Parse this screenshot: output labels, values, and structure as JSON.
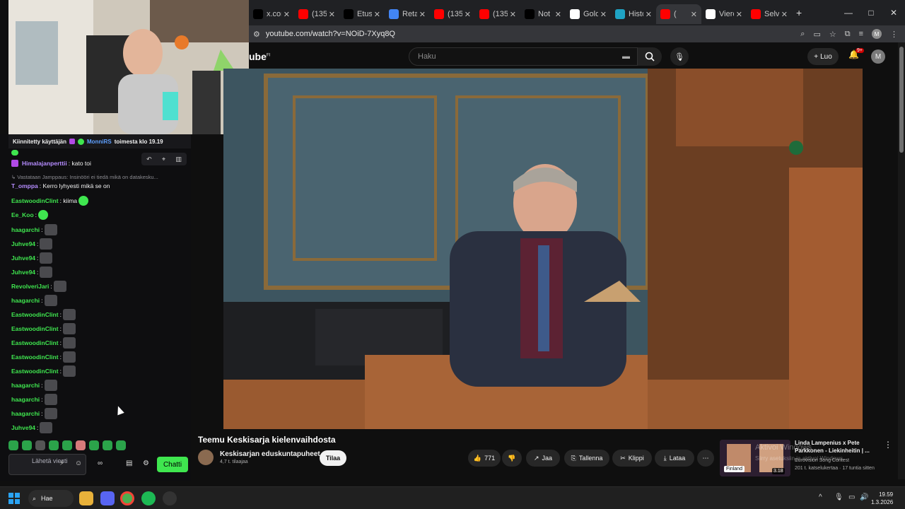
{
  "browser": {
    "tabs": [
      {
        "label": "x.com",
        "icon": "x-icon",
        "color": "#000000"
      },
      {
        "label": "(135",
        "icon": "youtube-icon",
        "color": "#ff0000"
      },
      {
        "label": "Etusi",
        "icon": "x-icon",
        "color": "#000000"
      },
      {
        "label": "Reta",
        "icon": "google-icon",
        "color": "#4285f4"
      },
      {
        "label": "(135",
        "icon": "youtube-icon",
        "color": "#ff0000"
      },
      {
        "label": "(135",
        "icon": "youtube-icon",
        "color": "#ff0000"
      },
      {
        "label": "Not",
        "icon": "x-icon",
        "color": "#000000"
      },
      {
        "label": "Gold",
        "icon": "doc-icon",
        "color": "#ffffff"
      },
      {
        "label": "Histo",
        "icon": "app-icon",
        "color": "#1fa3c4"
      },
      {
        "label": "(",
        "icon": "youtube-icon",
        "color": "#ff0000"
      },
      {
        "label": "Vierc",
        "icon": "doc-icon",
        "color": "#ffffff"
      },
      {
        "label": "Selvi",
        "icon": "youtube-icon",
        "color": "#ff0000"
      }
    ],
    "url": "youtube.com/watch?v=NOiD-7Xyq8Q",
    "profile_initial": "M"
  },
  "youtube": {
    "logo_text": "ube",
    "logo_region": "FI",
    "search_placeholder": "Haku",
    "create_label": "Luo",
    "notif_badge": "9+",
    "user_initial": "M",
    "video_title": "Teemu Keskisarja kielenvaihdosta",
    "channel_name": "Keskisarjan eduskuntapuheet",
    "channel_subs": "4,7 t. tilaajaa",
    "subscribe_label": "Tilaa",
    "likes": "771",
    "share_label": "Jaa",
    "save_label": "Tallenna",
    "clip_label": "Klippi",
    "download_label": "Lataa",
    "recommendation": {
      "title": "Linda Lampenius x Pete Parkkonen - Liekinheitin | ...",
      "channel": "Eurovision Song Contest",
      "views": "201 t. katselukertaa · 17 tuntia sitten",
      "duration": "3.18",
      "thumb_text": "Finland"
    },
    "watermark_line1": "Aktivoi Windows",
    "watermark_line2": "Siirry asetuksiin ja aktivoi Windows."
  },
  "chat": {
    "pinned_prefix": "Kiinnitetty käyttäjän",
    "pinned_user": "MonniRS",
    "pinned_suffix": "toimesta klo 19.19",
    "reply_context": "Vastataan Jamppaus: Insinööri ei tiedä mikä on datakesku...",
    "messages": [
      {
        "user": "Himalajanperttii",
        "text": ": kato toi",
        "color": "#ffffff"
      },
      {
        "user": "T_omppa",
        "text": ": Kerro lyhyesti mikä se on",
        "color": "#9b59ff"
      },
      {
        "user": "EastwoodinClint",
        "text": ": kiima",
        "color": "#3fe64f"
      },
      {
        "user": "Ee_Koo",
        "text": ":",
        "color": "#3fe64f"
      },
      {
        "user": "haagarchi",
        "text": ":",
        "color": "#3fe64f"
      },
      {
        "user": "Juhve94",
        "text": ":",
        "color": "#3fe64f"
      },
      {
        "user": "Juhve94",
        "text": ":",
        "color": "#3fe64f"
      },
      {
        "user": "Juhve94",
        "text": ":",
        "color": "#3fe64f"
      },
      {
        "user": "RevolveriJari",
        "text": ":",
        "color": "#3fe64f"
      },
      {
        "user": "haagarchi",
        "text": ":",
        "color": "#3fe64f"
      },
      {
        "user": "EastwoodinClint",
        "text": ":",
        "color": "#3fe64f"
      },
      {
        "user": "EastwoodinClint",
        "text": ":",
        "color": "#3fe64f"
      },
      {
        "user": "EastwoodinClint",
        "text": ":",
        "color": "#3fe64f"
      },
      {
        "user": "EastwoodinClint",
        "text": ":",
        "color": "#3fe64f"
      },
      {
        "user": "EastwoodinClint",
        "text": ":",
        "color": "#3fe64f"
      },
      {
        "user": "haagarchi",
        "text": ":",
        "color": "#3fe64f"
      },
      {
        "user": "haagarchi",
        "text": ":",
        "color": "#3fe64f"
      },
      {
        "user": "haagarchi",
        "text": ":",
        "color": "#3fe64f"
      },
      {
        "user": "Juhve94",
        "text": ":",
        "color": "#3fe64f"
      }
    ],
    "input_placeholder": "Lähetä viesti",
    "send_label": "Chatti"
  },
  "taskbar": {
    "search_label": "Hae",
    "time": "19.59",
    "date": "1.3.2026"
  }
}
